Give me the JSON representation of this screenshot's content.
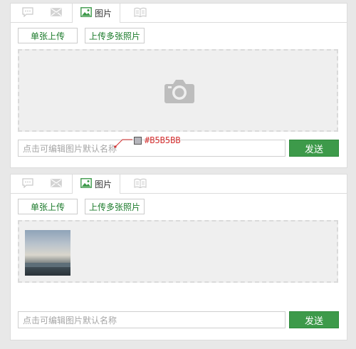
{
  "widget": {
    "tabs": [
      {
        "icon": "chat-bubble-icon",
        "label": ""
      },
      {
        "icon": "envelope-icon",
        "label": ""
      },
      {
        "icon": "image-icon",
        "label": "图片"
      },
      {
        "icon": "book-icon",
        "label": ""
      }
    ],
    "buttons": {
      "single": "单张上传",
      "multi": "上传多张照片"
    },
    "input_placeholder": "点击可编辑图片默认名称",
    "send_label": "发送"
  },
  "annotation": {
    "color_hex": "#B5B5BB",
    "swatch_color": "#B5B5BB"
  },
  "colors": {
    "accent": "#3d9a4a",
    "button_text": "#1a7a2a",
    "drop_area": "#efefef",
    "annotation_text": "#d43030"
  }
}
